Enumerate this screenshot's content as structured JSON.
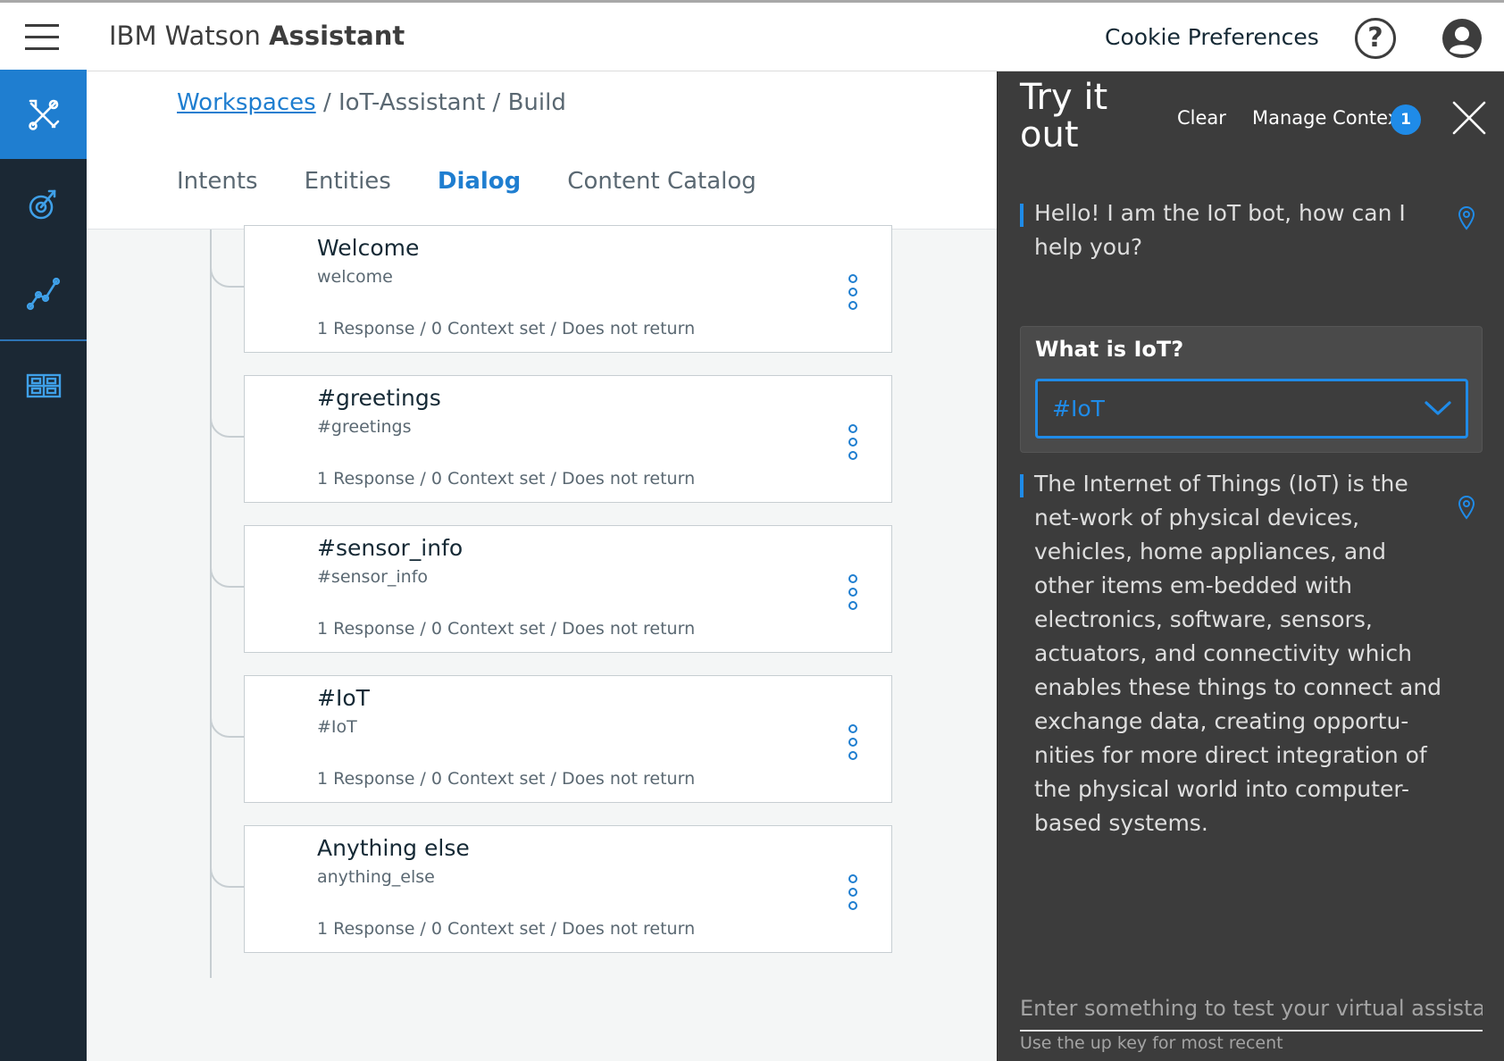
{
  "header": {
    "brand_prefix": "IBM Watson ",
    "brand_bold": "Assistant",
    "cookie_label": "Cookie Preferences",
    "help_glyph": "?"
  },
  "sidenav": {
    "items": [
      {
        "icon": "tools-icon",
        "active": true
      },
      {
        "icon": "improve-icon",
        "active": false
      },
      {
        "icon": "analytics-icon",
        "active": false
      },
      {
        "icon": "catalog-grid-icon",
        "active": false
      }
    ]
  },
  "breadcrumb": {
    "link": "Workspaces",
    "rest": "/ IoT-Assistant / Build"
  },
  "tabs": [
    {
      "label": "Intents",
      "active": false
    },
    {
      "label": "Entities",
      "active": false
    },
    {
      "label": "Dialog",
      "active": true
    },
    {
      "label": "Content Catalog",
      "active": false
    }
  ],
  "nodes": [
    {
      "title": "Welcome",
      "condition": "welcome",
      "meta": "1 Response / 0 Context set / Does not return"
    },
    {
      "title": "#greetings",
      "condition": "#greetings",
      "meta": "1 Response / 0 Context set / Does not return"
    },
    {
      "title": "#sensor_info",
      "condition": "#sensor_info",
      "meta": "1 Response / 0 Context set / Does not return"
    },
    {
      "title": "#IoT",
      "condition": "#IoT",
      "meta": "1 Response / 0 Context set / Does not return"
    },
    {
      "title": "Anything else",
      "condition": "anything_else",
      "meta": "1 Response / 0 Context set / Does not return"
    }
  ],
  "panel": {
    "title": "Try it out",
    "clear_label": "Clear",
    "context_label": "Manage Context",
    "context_count": "1",
    "bot_greeting": "Hello! I am the IoT bot, how can I help you?",
    "user_message": "What is IoT?",
    "detected_intent": "#IoT",
    "bot_answer": "The Internet of Things (IoT) is the net-work of physical devices, vehicles, home appliances, and other items em-bedded with electronics, software, sensors, actuators, and connectivity which enables these things to connect and exchange data, creating opportu-nities for more direct integration of the physical world into computer-based systems.",
    "input_placeholder": "Enter something to test your virtual assistan",
    "input_hint": "Use the up key for most recent"
  },
  "colors": {
    "accent": "#1f7ed0",
    "sidenav_bg": "#1b2834",
    "panel_bg": "#3c3c3c"
  }
}
